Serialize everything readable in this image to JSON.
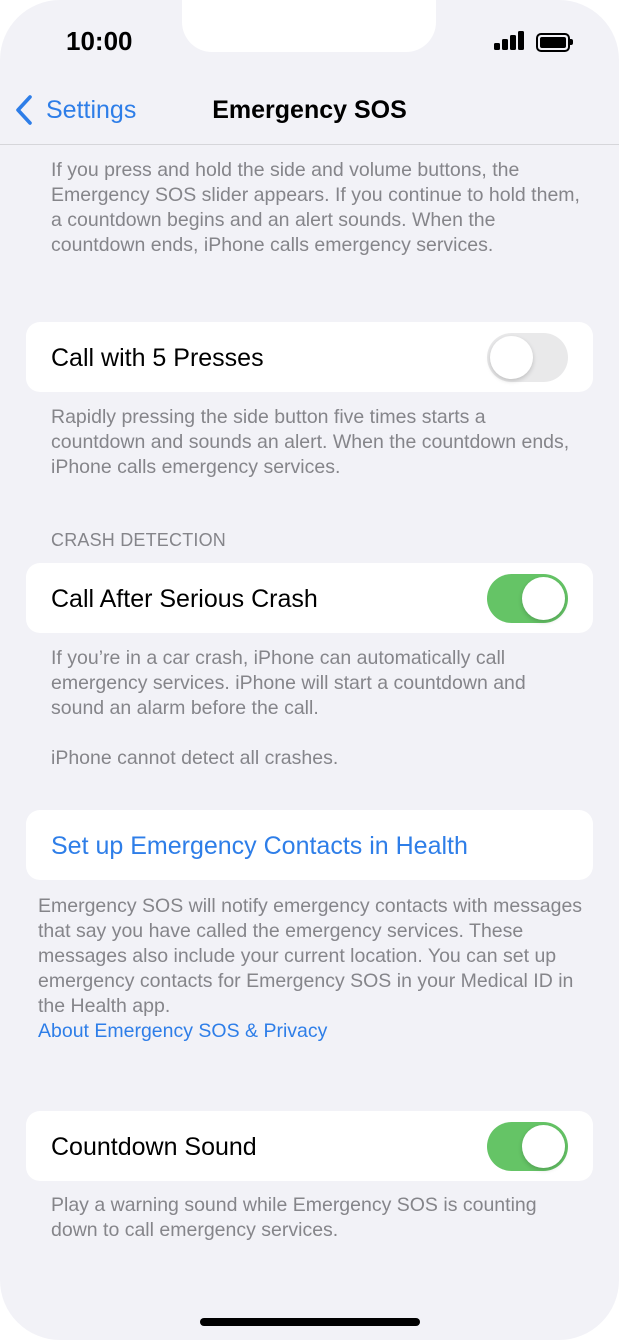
{
  "status_bar": {
    "time": "10:00"
  },
  "nav": {
    "back_label": "Settings",
    "title": "Emergency SOS"
  },
  "intro_text": "If you press and hold the side and volume buttons, the Emergency SOS slider appears. If you continue to hold them, a countdown begins and an alert sounds. When the countdown ends, iPhone calls emergency services.",
  "call_with_5_presses": {
    "label": "Call with 5 Presses",
    "enabled": false,
    "footer": "Rapidly pressing the side button five times starts a countdown and sounds an alert. When the countdown ends, iPhone calls emergency services."
  },
  "crash_detection": {
    "header": "CRASH DETECTION",
    "label": "Call After Serious Crash",
    "enabled": true,
    "footer": "If you’re in a car crash, iPhone can automatically call emergency services. iPhone will start a countdown and sound an alarm before the call.",
    "footer_note": "iPhone cannot detect all crashes."
  },
  "emergency_contacts": {
    "label": "Set up Emergency Contacts in Health",
    "footer": "Emergency SOS will notify emergency contacts with messages that say you have called the emergency services. These messages also include your current location. You can set up emergency contacts for Emergency SOS in your Medical ID in the Health app.",
    "privacy_link": "About Emergency SOS & Privacy"
  },
  "countdown_sound": {
    "label": "Countdown Sound",
    "enabled": true,
    "footer": "Play a warning sound while Emergency SOS is counting down to call emergency services."
  },
  "colors": {
    "accent": "#2e7ee8",
    "toggle_on": "#65c466",
    "toggle_off": "#e9e9ea",
    "background": "#f2f2f7"
  }
}
